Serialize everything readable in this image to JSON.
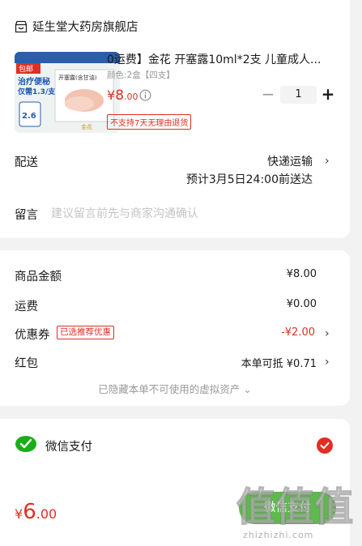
{
  "shop": {
    "name": "延生堂大药房旗舰店",
    "icon": "shop-icon"
  },
  "product": {
    "title": "0运费】金花 开塞露10ml*2支 儿童成人...",
    "variant": "颜色:2盒【四支】",
    "price_symbol": "¥",
    "price_int": "8",
    "price_dec": ".00",
    "quantity": "1",
    "no_return_tag": "不支持7天无理由退货",
    "thumb": {
      "badge": "包邮",
      "line1": "治疗便秘",
      "line2": "仅需1.3/支",
      "promo": "2.6",
      "brand": "开塞露(含甘油)",
      "maker": "金花"
    }
  },
  "delivery": {
    "label": "配送",
    "method": "快递运输",
    "eta": "预计3月5日24:00前送达"
  },
  "message": {
    "label": "留言",
    "placeholder": "建议留言前先与商家沟通确认"
  },
  "summary": {
    "goods_label": "商品金额",
    "goods_value": "¥8.00",
    "shipping_label": "运费",
    "shipping_value": "¥0.00",
    "coupon_label": "优惠券",
    "coupon_tag": "已选推荐优惠",
    "coupon_value": "-¥2.00",
    "redpacket_label": "红包",
    "redpacket_value": "本单可抵 ¥0.71",
    "hidden_note": "已隐藏本单不可使用的虚拟资产 ⌄"
  },
  "payment": {
    "method": "微信支付",
    "total_symbol": "¥",
    "total_int": "6",
    "total_dec": ".00",
    "button": "微信支付"
  },
  "watermark": {
    "text": "值",
    "domain": "zhizhizhi.com"
  },
  "colors": {
    "accent": "#e02e24",
    "wechat": "#5dbb4b",
    "background": "#f2f2f2"
  }
}
